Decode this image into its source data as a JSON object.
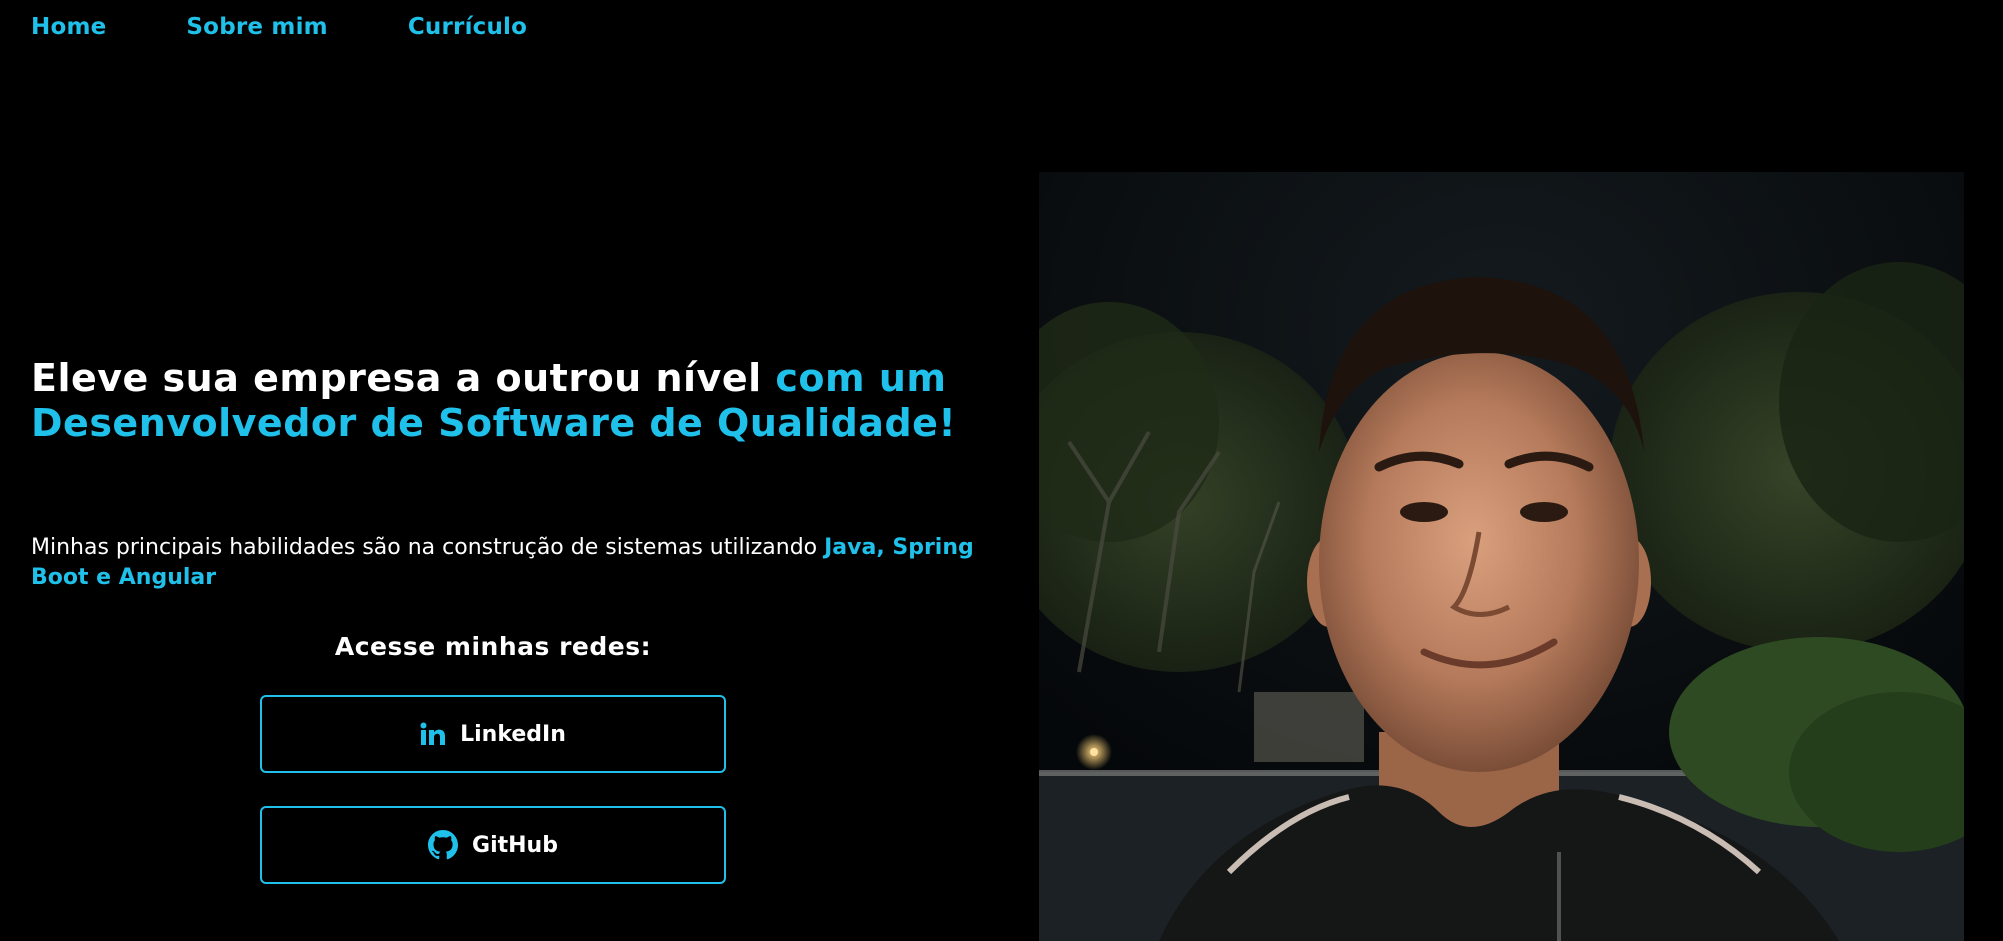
{
  "nav": {
    "items": [
      "Home",
      "Sobre mim",
      "Currículo"
    ]
  },
  "hero": {
    "headline_white": "Eleve sua empresa a outrou nível",
    "headline_accent": "com um Desenvolvedor de Software de Qualidade!",
    "skills_text": "Minhas principais habilidades são na construção de sistemas utilizando",
    "skills_highlight": "Java, Spring Boot e Angular"
  },
  "social": {
    "title": "Acesse minhas redes:",
    "buttons": [
      {
        "label": "LinkedIn",
        "icon": "linkedin-icon"
      },
      {
        "label": "GitHub",
        "icon": "github-icon"
      }
    ]
  },
  "colors": {
    "accent": "#1fc0ea",
    "background": "#000000",
    "text": "#ffffff"
  }
}
